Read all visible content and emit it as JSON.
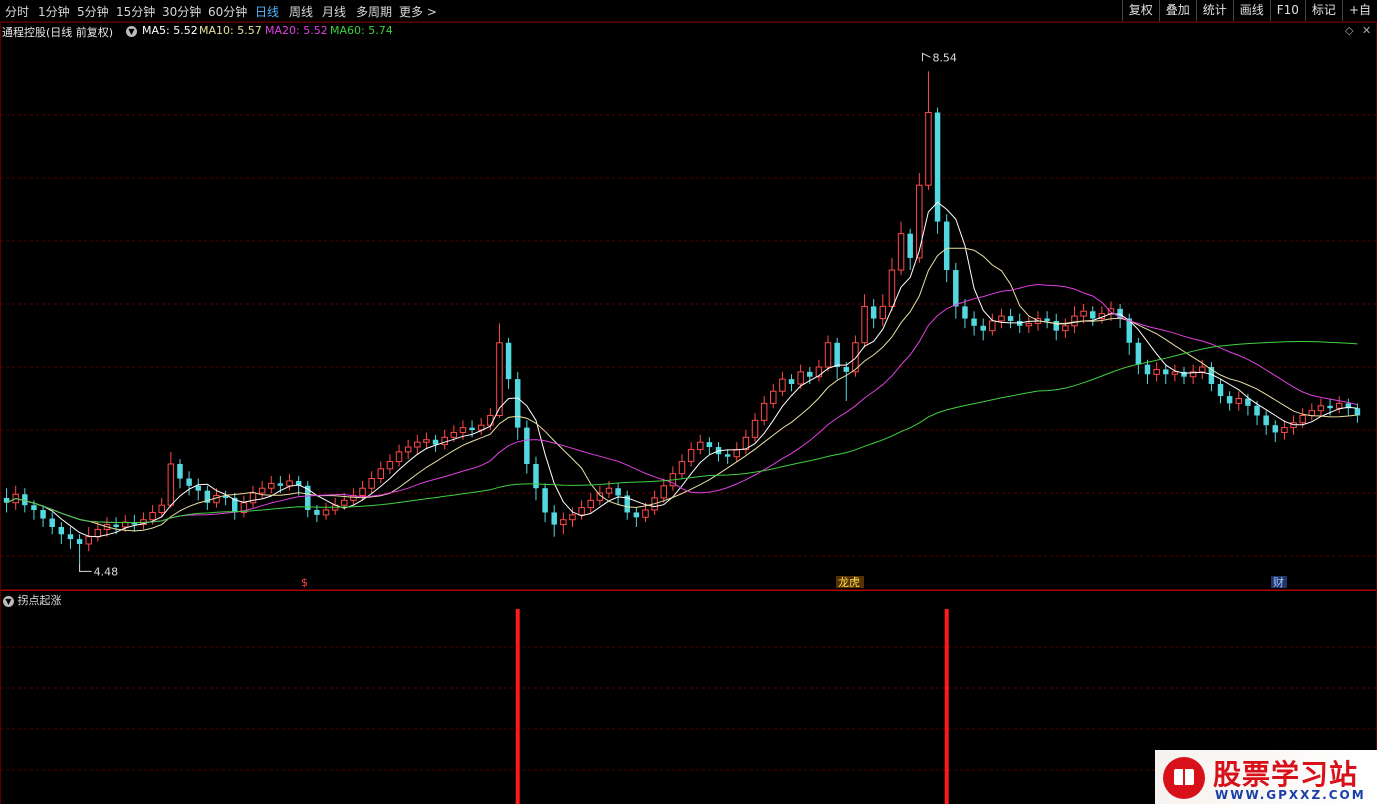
{
  "toolbar": {
    "periods": [
      "分时",
      "1分钟",
      "5分钟",
      "15分钟",
      "30分钟",
      "60分钟",
      "日线",
      "周线",
      "月线",
      "多周期",
      "更多 >"
    ],
    "active_period": "日线",
    "tools": [
      "复权",
      "叠加",
      "统计",
      "画线",
      "F10",
      "标记",
      "+自"
    ]
  },
  "info": {
    "title": "通程控股(日线 前复权)",
    "ma5": "MA5: 5.52",
    "ma10": "MA10: 5.57",
    "ma20": "MA20: 5.52",
    "ma60": "MA60: 5.74"
  },
  "markers": {
    "high": "8.54",
    "low": "4.48",
    "event1": "$",
    "event2": "龙虎",
    "event3": "财"
  },
  "indicator": {
    "name": "拐点起涨"
  },
  "watermark": {
    "title": "股票学习站",
    "url": "WWW.GPXXZ.COM"
  },
  "colors": {
    "up": "#ff4a4a",
    "down": "#54d8e0",
    "ma5": "#ffffff",
    "ma10": "#e8e0a0",
    "ma20": "#e040e0",
    "ma60": "#40d040",
    "signal": "#ff1a1a",
    "grid": "#5a0000"
  },
  "chart_data": {
    "type": "candlestick",
    "title": "通程控股(日线 前复权)",
    "price_range": [
      4.48,
      8.54
    ],
    "candles": [
      [
        5.02,
        4.98,
        5.1,
        4.9
      ],
      [
        4.98,
        5.05,
        5.12,
        4.92
      ],
      [
        5.05,
        4.96,
        5.1,
        4.9
      ],
      [
        4.96,
        4.92,
        5.0,
        4.84
      ],
      [
        4.92,
        4.85,
        4.96,
        4.78
      ],
      [
        4.85,
        4.78,
        4.9,
        4.72
      ],
      [
        4.78,
        4.72,
        4.82,
        4.64
      ],
      [
        4.72,
        4.68,
        4.78,
        4.6
      ],
      [
        4.68,
        4.64,
        4.72,
        4.48
      ],
      [
        4.64,
        4.7,
        4.78,
        4.58
      ],
      [
        4.7,
        4.76,
        4.82,
        4.66
      ],
      [
        4.76,
        4.8,
        4.86,
        4.7
      ],
      [
        4.8,
        4.78,
        4.86,
        4.72
      ],
      [
        4.78,
        4.82,
        4.88,
        4.74
      ],
      [
        4.82,
        4.8,
        4.88,
        4.74
      ],
      [
        4.8,
        4.84,
        4.9,
        4.76
      ],
      [
        4.84,
        4.9,
        4.96,
        4.8
      ],
      [
        4.9,
        4.96,
        5.02,
        4.86
      ],
      [
        4.96,
        5.3,
        5.4,
        4.94
      ],
      [
        5.3,
        5.18,
        5.34,
        5.1
      ],
      [
        5.18,
        5.12,
        5.24,
        5.04
      ],
      [
        5.12,
        5.08,
        5.18,
        5.0
      ],
      [
        5.08,
        4.98,
        5.12,
        4.92
      ],
      [
        4.98,
        5.04,
        5.1,
        4.94
      ],
      [
        5.04,
        5.02,
        5.08,
        4.96
      ],
      [
        5.02,
        4.9,
        5.06,
        4.84
      ],
      [
        4.9,
        4.98,
        5.04,
        4.86
      ],
      [
        4.98,
        5.06,
        5.12,
        4.94
      ],
      [
        5.06,
        5.1,
        5.16,
        5.02
      ],
      [
        5.1,
        5.14,
        5.2,
        5.06
      ],
      [
        5.14,
        5.12,
        5.2,
        5.06
      ],
      [
        5.12,
        5.16,
        5.22,
        5.08
      ],
      [
        5.16,
        5.12,
        5.2,
        5.04
      ],
      [
        5.12,
        4.92,
        5.16,
        4.86
      ],
      [
        4.92,
        4.88,
        4.96,
        4.82
      ],
      [
        4.88,
        4.92,
        4.98,
        4.84
      ],
      [
        4.92,
        4.96,
        5.02,
        4.88
      ],
      [
        4.96,
        5.0,
        5.06,
        4.92
      ],
      [
        5.0,
        5.04,
        5.1,
        4.96
      ],
      [
        5.04,
        5.1,
        5.16,
        5.0
      ],
      [
        5.1,
        5.18,
        5.24,
        5.06
      ],
      [
        5.18,
        5.26,
        5.32,
        5.14
      ],
      [
        5.26,
        5.32,
        5.38,
        5.22
      ],
      [
        5.32,
        5.4,
        5.46,
        5.28
      ],
      [
        5.4,
        5.44,
        5.5,
        5.34
      ],
      [
        5.44,
        5.48,
        5.54,
        5.38
      ],
      [
        5.48,
        5.5,
        5.56,
        5.42
      ],
      [
        5.5,
        5.46,
        5.54,
        5.4
      ],
      [
        5.46,
        5.52,
        5.58,
        5.42
      ],
      [
        5.52,
        5.56,
        5.62,
        5.48
      ],
      [
        5.56,
        5.6,
        5.66,
        5.5
      ],
      [
        5.6,
        5.58,
        5.66,
        5.52
      ],
      [
        5.58,
        5.62,
        5.68,
        5.54
      ],
      [
        5.62,
        5.7,
        5.76,
        5.58
      ],
      [
        5.7,
        6.3,
        6.46,
        5.68
      ],
      [
        6.3,
        6.0,
        6.34,
        5.92
      ],
      [
        6.0,
        5.6,
        6.06,
        5.5
      ],
      [
        5.6,
        5.3,
        5.66,
        5.22
      ],
      [
        5.3,
        5.1,
        5.36,
        5.0
      ],
      [
        5.1,
        4.9,
        5.14,
        4.82
      ],
      [
        4.9,
        4.8,
        4.96,
        4.7
      ],
      [
        4.8,
        4.84,
        4.9,
        4.72
      ],
      [
        4.84,
        4.88,
        4.94,
        4.78
      ],
      [
        4.88,
        4.94,
        5.0,
        4.84
      ],
      [
        4.94,
        5.0,
        5.06,
        4.9
      ],
      [
        5.0,
        5.06,
        5.12,
        4.96
      ],
      [
        5.06,
        5.1,
        5.16,
        5.02
      ],
      [
        5.1,
        5.04,
        5.14,
        4.96
      ],
      [
        5.04,
        4.9,
        5.08,
        4.84
      ],
      [
        4.9,
        4.86,
        4.94,
        4.78
      ],
      [
        4.86,
        4.92,
        4.98,
        4.82
      ],
      [
        4.92,
        5.02,
        5.08,
        4.88
      ],
      [
        5.02,
        5.12,
        5.18,
        4.98
      ],
      [
        5.12,
        5.22,
        5.28,
        5.08
      ],
      [
        5.22,
        5.32,
        5.38,
        5.18
      ],
      [
        5.32,
        5.42,
        5.48,
        5.28
      ],
      [
        5.42,
        5.48,
        5.54,
        5.38
      ],
      [
        5.48,
        5.44,
        5.52,
        5.38
      ],
      [
        5.44,
        5.38,
        5.48,
        5.32
      ],
      [
        5.38,
        5.36,
        5.42,
        5.3
      ],
      [
        5.36,
        5.42,
        5.48,
        5.32
      ],
      [
        5.42,
        5.52,
        5.58,
        5.38
      ],
      [
        5.52,
        5.66,
        5.72,
        5.48
      ],
      [
        5.66,
        5.8,
        5.86,
        5.62
      ],
      [
        5.8,
        5.9,
        5.96,
        5.76
      ],
      [
        5.9,
        6.0,
        6.06,
        5.86
      ],
      [
        6.0,
        5.96,
        6.04,
        5.9
      ],
      [
        5.96,
        6.06,
        6.12,
        5.92
      ],
      [
        6.06,
        6.02,
        6.1,
        5.96
      ],
      [
        6.02,
        6.1,
        6.16,
        5.98
      ],
      [
        6.1,
        6.3,
        6.36,
        6.06
      ],
      [
        6.3,
        6.1,
        6.34,
        6.0
      ],
      [
        6.1,
        6.06,
        6.14,
        5.82
      ],
      [
        6.06,
        6.3,
        6.36,
        6.02
      ],
      [
        6.3,
        6.6,
        6.7,
        6.26
      ],
      [
        6.6,
        6.5,
        6.66,
        6.42
      ],
      [
        6.5,
        6.6,
        6.7,
        6.44
      ],
      [
        6.6,
        6.9,
        7.0,
        6.56
      ],
      [
        6.9,
        7.2,
        7.3,
        6.86
      ],
      [
        7.2,
        7.0,
        7.24,
        6.9
      ],
      [
        7.0,
        7.6,
        7.7,
        6.96
      ],
      [
        7.6,
        8.2,
        8.54,
        7.56
      ],
      [
        8.2,
        7.3,
        8.24,
        7.2
      ],
      [
        7.3,
        6.9,
        7.36,
        6.8
      ],
      [
        6.9,
        6.6,
        6.96,
        6.5
      ],
      [
        6.6,
        6.5,
        6.66,
        6.42
      ],
      [
        6.5,
        6.44,
        6.56,
        6.36
      ],
      [
        6.44,
        6.4,
        6.5,
        6.32
      ],
      [
        6.4,
        6.48,
        6.54,
        6.36
      ],
      [
        6.48,
        6.52,
        6.58,
        6.42
      ],
      [
        6.52,
        6.48,
        6.58,
        6.42
      ],
      [
        6.48,
        6.44,
        6.54,
        6.38
      ],
      [
        6.44,
        6.46,
        6.52,
        6.38
      ],
      [
        6.46,
        6.5,
        6.56,
        6.4
      ],
      [
        6.5,
        6.48,
        6.56,
        6.42
      ],
      [
        6.48,
        6.4,
        6.54,
        6.32
      ],
      [
        6.4,
        6.44,
        6.5,
        6.34
      ],
      [
        6.44,
        6.52,
        6.6,
        6.38
      ],
      [
        6.52,
        6.56,
        6.62,
        6.46
      ],
      [
        6.56,
        6.5,
        6.6,
        6.44
      ],
      [
        6.5,
        6.54,
        6.6,
        6.46
      ],
      [
        6.54,
        6.58,
        6.64,
        6.48
      ],
      [
        6.58,
        6.5,
        6.62,
        6.42
      ],
      [
        6.5,
        6.3,
        6.54,
        6.2
      ],
      [
        6.3,
        6.12,
        6.34,
        6.04
      ],
      [
        6.12,
        6.04,
        6.16,
        5.96
      ],
      [
        6.04,
        6.08,
        6.14,
        5.98
      ],
      [
        6.08,
        6.04,
        6.12,
        5.96
      ],
      [
        6.04,
        6.06,
        6.12,
        5.98
      ],
      [
        6.06,
        6.02,
        6.1,
        5.96
      ],
      [
        6.02,
        6.06,
        6.12,
        5.96
      ],
      [
        6.06,
        6.1,
        6.16,
        6.0
      ],
      [
        6.1,
        5.96,
        6.14,
        5.9
      ],
      [
        5.96,
        5.86,
        6.0,
        5.8
      ],
      [
        5.86,
        5.8,
        5.9,
        5.74
      ],
      [
        5.8,
        5.84,
        5.9,
        5.74
      ],
      [
        5.84,
        5.78,
        5.88,
        5.7
      ],
      [
        5.78,
        5.7,
        5.82,
        5.62
      ],
      [
        5.7,
        5.62,
        5.74,
        5.54
      ],
      [
        5.62,
        5.56,
        5.66,
        5.48
      ],
      [
        5.56,
        5.6,
        5.66,
        5.5
      ],
      [
        5.6,
        5.64,
        5.7,
        5.54
      ],
      [
        5.64,
        5.7,
        5.76,
        5.6
      ],
      [
        5.7,
        5.74,
        5.8,
        5.66
      ],
      [
        5.74,
        5.78,
        5.84,
        5.7
      ],
      [
        5.78,
        5.76,
        5.84,
        5.7
      ],
      [
        5.76,
        5.8,
        5.86,
        5.72
      ],
      [
        5.8,
        5.76,
        5.84,
        5.7
      ],
      [
        5.76,
        5.7,
        5.8,
        5.64
      ]
    ],
    "signals_bar_index": [
      56,
      103
    ]
  }
}
